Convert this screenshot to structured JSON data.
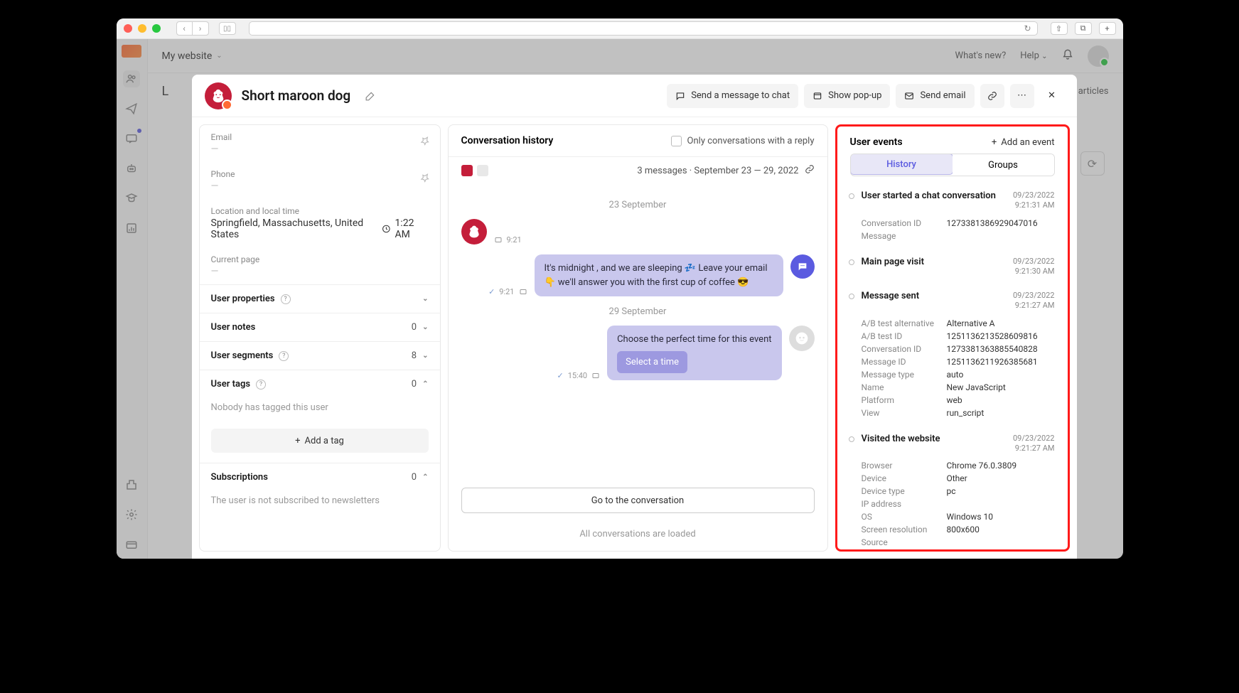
{
  "browser": {
    "share_icon": "share",
    "tabs_icon": "tabs"
  },
  "app": {
    "workspace": "My website",
    "whats_new": "What's new?",
    "help": "Help",
    "page_letter": "L",
    "articles": "to articles"
  },
  "user": {
    "name": "Short maroon dog"
  },
  "header_buttons": {
    "send_msg": "Send a message to chat",
    "show_popup": "Show pop-up",
    "send_email": "Send email"
  },
  "left_panel": {
    "email_label": "Email",
    "email_val": "—",
    "phone_label": "Phone",
    "phone_val": "—",
    "loc_label": "Location and local time",
    "loc_val": "Springfield, Massachusetts, United States",
    "loc_time": "1:22 AM",
    "page_label": "Current page",
    "page_val": "—",
    "sections": {
      "props": "User properties",
      "notes": "User notes",
      "notes_count": "0",
      "segments": "User segments",
      "segments_count": "8",
      "tags": "User tags",
      "tags_count": "0",
      "tags_empty": "Nobody has tagged this user",
      "add_tag": "Add a tag",
      "subs": "Subscriptions",
      "subs_count": "0",
      "subs_empty": "The user is not subscribed to newsletters"
    }
  },
  "conv": {
    "title": "Conversation history",
    "filter": "Only conversations with a reply",
    "meta": "3 messages · September 23 — 29, 2022",
    "date1": "23 September",
    "msg1_time": "9:21",
    "msg2": "It's midnight , and we are sleeping 💤 Leave your email 👇 we'll answer you with the first cup of coffee 😎",
    "msg2_time": "9:21",
    "date2": "29 September",
    "msg3": "Choose the perfect time for this event",
    "msg3_chip": "Select a time",
    "msg3_time": "15:40",
    "go_btn": "Go to the conversation",
    "loaded": "All conversations are loaded"
  },
  "events": {
    "title": "User events",
    "add": "Add an event",
    "tab_history": "History",
    "tab_groups": "Groups",
    "items": [
      {
        "name": "User started a chat conversation",
        "date": "09/23/2022",
        "time": "9:21:31 AM",
        "props": [
          {
            "k": "Conversation ID",
            "v": "1273381386929047016"
          },
          {
            "k": "Message",
            "v": ""
          }
        ]
      },
      {
        "name": "Main page visit",
        "date": "09/23/2022",
        "time": "9:21:30 AM",
        "props": []
      },
      {
        "name": "Message sent",
        "date": "09/23/2022",
        "time": "9:21:27 AM",
        "props": [
          {
            "k": "A/B test alternative",
            "v": "Alternative A"
          },
          {
            "k": "A/B test ID",
            "v": "1251136213528609816"
          },
          {
            "k": "Conversation ID",
            "v": "1273381363885540828"
          },
          {
            "k": "Message ID",
            "v": "1251136211926385681"
          },
          {
            "k": "Message type",
            "v": "auto"
          },
          {
            "k": "Name",
            "v": "New JavaScript"
          },
          {
            "k": "Platform",
            "v": "web"
          },
          {
            "k": "View",
            "v": "run_script"
          }
        ]
      },
      {
        "name": "Visited the website",
        "date": "09/23/2022",
        "time": "9:21:27 AM",
        "props": [
          {
            "k": "Browser",
            "v": "Chrome 76.0.3809"
          },
          {
            "k": "Device",
            "v": "Other"
          },
          {
            "k": "Device type",
            "v": "pc"
          },
          {
            "k": "IP address",
            "v": ""
          },
          {
            "k": "OS",
            "v": "Windows 10"
          },
          {
            "k": "Screen resolution",
            "v": "800x600"
          },
          {
            "k": "Source",
            "v": ""
          }
        ]
      }
    ]
  }
}
